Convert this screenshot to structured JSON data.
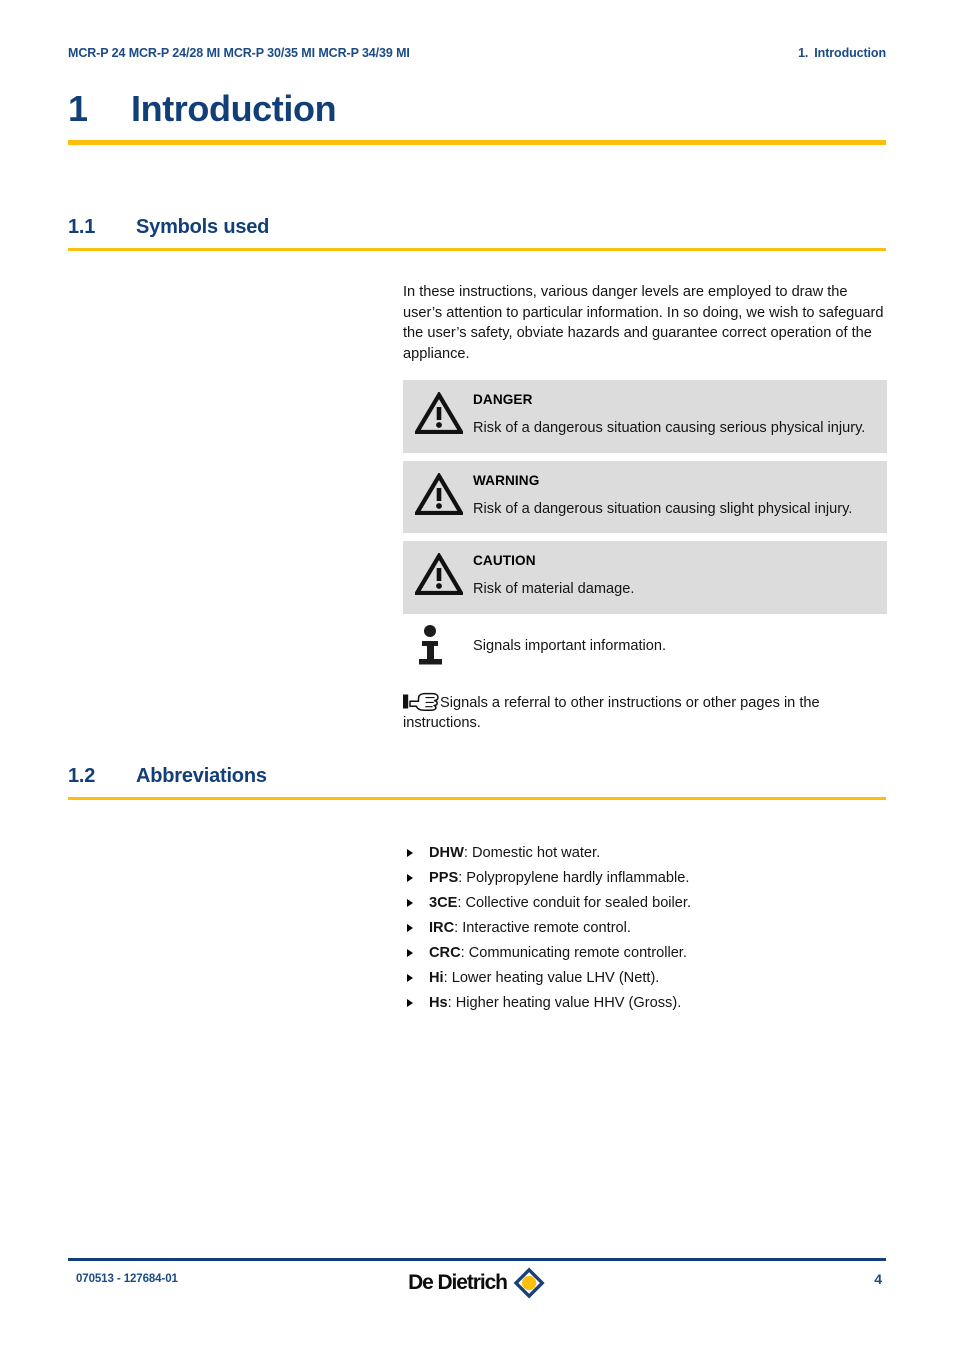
{
  "header": {
    "left": "MCR-P 24 MCR-P 24/28 MI MCR-P 30/35 MI MCR-P 34/39 MI",
    "right_number": "1.",
    "right_label": "Introduction"
  },
  "chapter": {
    "number": "1",
    "title": "Introduction"
  },
  "sections": {
    "symbols": {
      "number": "1.1",
      "title": "Symbols used",
      "intro": "In these instructions, various danger levels are employed to draw the user’s attention to particular information. In so doing, we wish to safeguard the user’s safety, obviate hazards and guarantee correct operation of the appliance.",
      "alerts": [
        {
          "icon": "warning-triangle-icon",
          "title": "DANGER",
          "text": "Risk of a dangerous situation causing serious physical injury."
        },
        {
          "icon": "warning-triangle-icon",
          "title": "WARNING",
          "text": "Risk of a dangerous situation causing slight physical injury."
        },
        {
          "icon": "warning-triangle-icon",
          "title": "CAUTION",
          "text": "Risk of material damage."
        }
      ],
      "info": {
        "icon": "information-icon",
        "text": "Signals important information."
      },
      "referral": {
        "icon": "pointing-hand-icon",
        "text": "Signals a referral to other instructions or other pages in the instructions."
      }
    },
    "abbreviations": {
      "number": "1.2",
      "title": "Abbreviations",
      "items": [
        {
          "term": "DHW",
          "definition": ": Domestic hot water."
        },
        {
          "term": "PPS",
          "definition": ": Polypropylene hardly inflammable."
        },
        {
          "term": "3CE",
          "definition": ": Collective conduit for sealed boiler."
        },
        {
          "term": "IRC",
          "definition": ": Interactive remote control."
        },
        {
          "term": "CRC",
          "definition": ": Communicating remote controller."
        },
        {
          "term": "Hi",
          "definition": ": Lower heating value LHV (Nett)."
        },
        {
          "term": "Hs",
          "definition": ": Higher heating value HHV (Gross)."
        }
      ]
    }
  },
  "footer": {
    "document_code": "070513 - 127684-01",
    "brand": "De Dietrich",
    "page_number": "4"
  },
  "colors": {
    "heading_blue": "#123f78",
    "header_blue": "#1b4b87",
    "rule_gold": "#fbc00d",
    "alert_bg": "#dcdcdc",
    "logo_diamond": "#1b3f7a",
    "logo_dot": "#fbc00d"
  }
}
